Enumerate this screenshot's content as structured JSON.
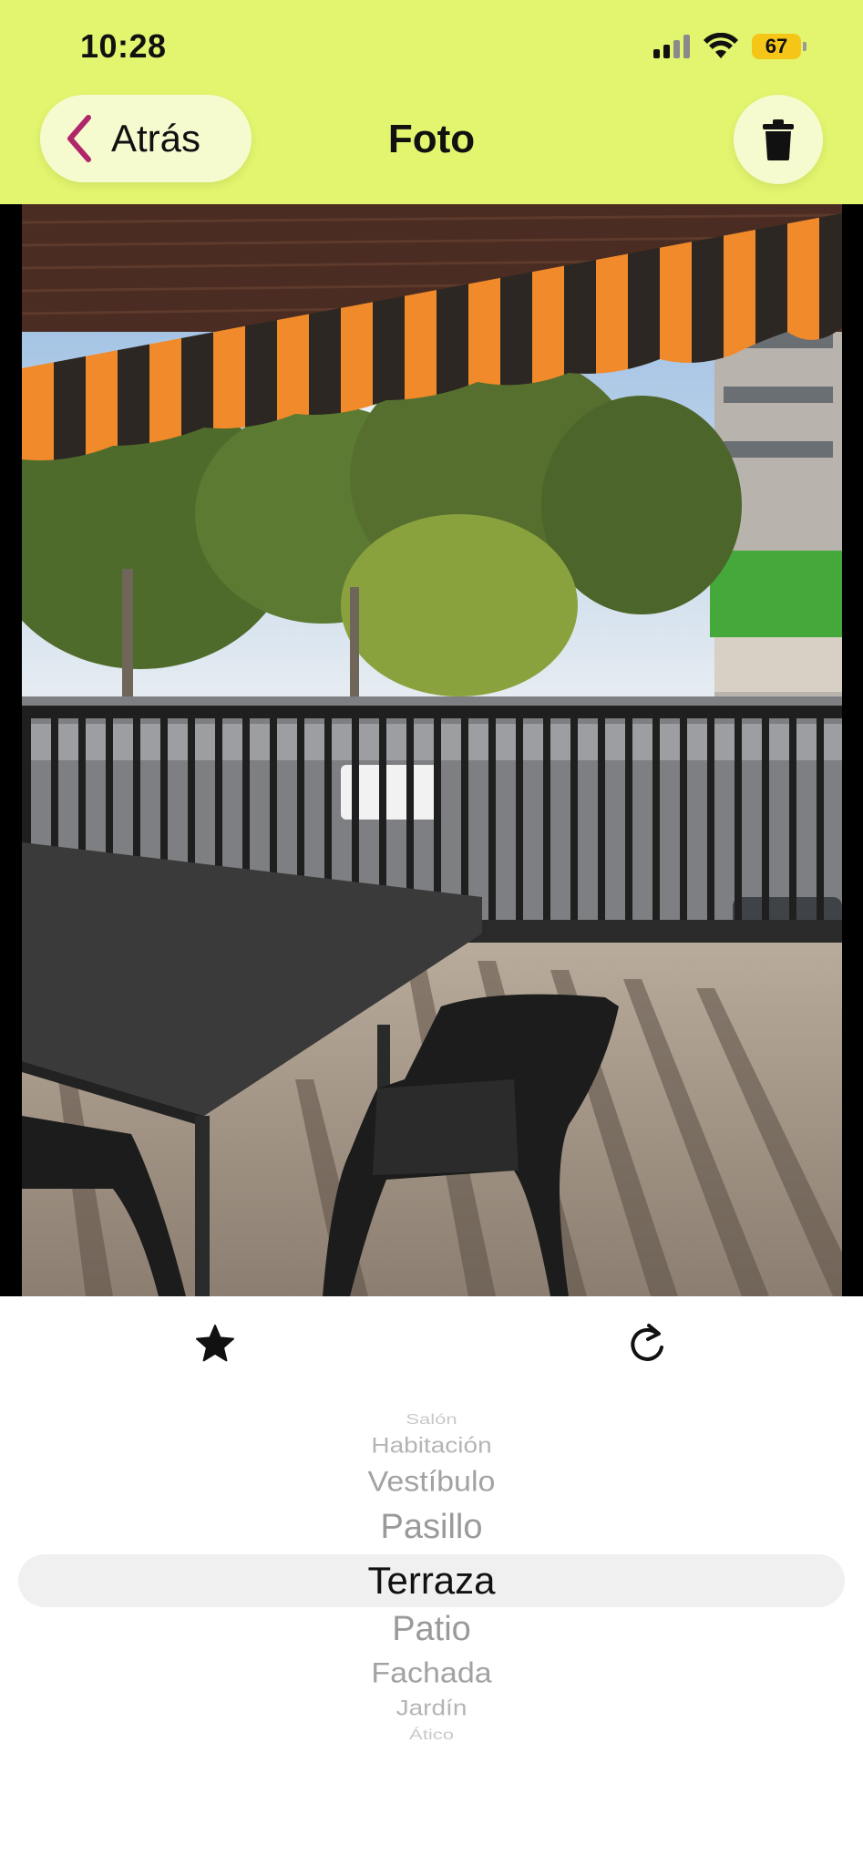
{
  "status_bar": {
    "time": "10:28",
    "battery": "67",
    "icons": [
      "signal-icon",
      "wifi-icon",
      "battery-icon"
    ]
  },
  "header": {
    "back_label": "Atrás",
    "title": "Foto",
    "back_icon": "chevron-left-icon",
    "delete_icon": "trash-icon"
  },
  "actions": {
    "favorite_icon": "star-icon",
    "rotate_icon": "rotate-icon"
  },
  "picker": {
    "items": [
      "Salón",
      "Habitación",
      "Vestíbulo",
      "Pasillo",
      "Terraza",
      "Patio",
      "Fachada",
      "Jardín",
      "Ático"
    ],
    "selected": "Terraza"
  },
  "colors": {
    "header_bg": "#e3f56e",
    "button_bg": "#f6fbcf",
    "accent": "#b0266b",
    "battery": "#f5c518",
    "picker_highlight": "#f0f0f0"
  }
}
